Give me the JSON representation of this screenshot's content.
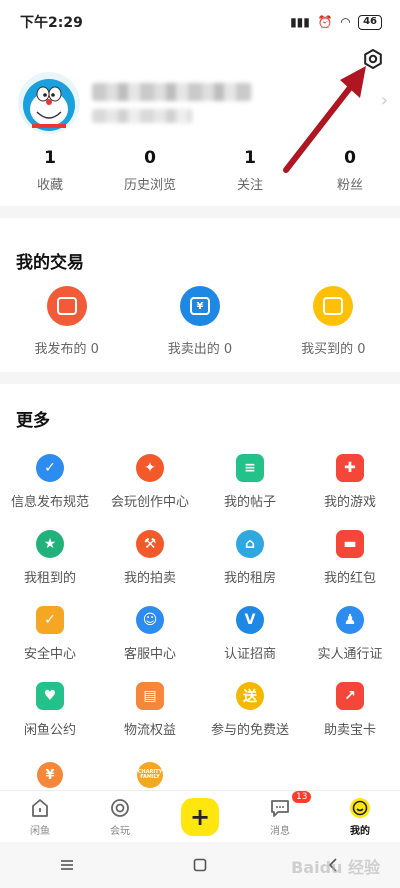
{
  "status_bar": {
    "time": "下午2:29",
    "battery": "46"
  },
  "stats": [
    {
      "value": "1",
      "label": "收藏"
    },
    {
      "value": "0",
      "label": "历史浏览"
    },
    {
      "value": "1",
      "label": "关注"
    },
    {
      "value": "0",
      "label": "粉丝"
    }
  ],
  "trade": {
    "title": "我的交易",
    "items": [
      {
        "label": "我发布的 0",
        "color": "#f25a38",
        "glyph": ""
      },
      {
        "label": "我卖出的 0",
        "color": "#1e88e5",
        "glyph": "¥"
      },
      {
        "label": "我买到的 0",
        "color": "#ffc107",
        "glyph": ""
      }
    ]
  },
  "more": {
    "title": "更多",
    "items": [
      {
        "label": "信息发布规范",
        "color": "#2d8cf0",
        "glyph": "✓"
      },
      {
        "label": "会玩创作中心",
        "color": "#f4592b",
        "glyph": "✦"
      },
      {
        "label": "我的帖子",
        "color": "#22c28a",
        "glyph": "≡"
      },
      {
        "label": "我的游戏",
        "color": "#f4473a",
        "glyph": "✚"
      },
      {
        "label": "我租到的",
        "color": "#20b27a",
        "glyph": "★"
      },
      {
        "label": "我的拍卖",
        "color": "#f4592b",
        "glyph": "⚒"
      },
      {
        "label": "我的租房",
        "color": "#2fa8e0",
        "glyph": "⌂"
      },
      {
        "label": "我的红包",
        "color": "#f4473a",
        "glyph": "▬"
      },
      {
        "label": "安全中心",
        "color": "#f5a623",
        "glyph": "✓"
      },
      {
        "label": "客服中心",
        "color": "#2d8cf0",
        "glyph": "☺"
      },
      {
        "label": "认证招商",
        "color": "#1e88e5",
        "glyph": "V"
      },
      {
        "label": "实人通行证",
        "color": "#2d8cf0",
        "glyph": "♟"
      },
      {
        "label": "闲鱼公约",
        "color": "#22c28a",
        "glyph": "♥"
      },
      {
        "label": "物流权益",
        "color": "#f5873b",
        "glyph": "▤"
      },
      {
        "label": "参与的免费送",
        "color": "#f5b800",
        "glyph": "送"
      },
      {
        "label": "助卖宝卡",
        "color": "#f4473a",
        "glyph": "↗"
      }
    ],
    "extra": [
      {
        "name": "money-bag-icon",
        "color": "#f5873b",
        "glyph": "¥"
      },
      {
        "name": "charity-family-icon",
        "color": "#f5a623",
        "glyph": "CHARITY FAMILY"
      }
    ]
  },
  "tabbar": {
    "tabs": [
      {
        "label": "闲鱼"
      },
      {
        "label": "会玩"
      },
      {
        "label": ""
      },
      {
        "label": "消息",
        "badge": "13"
      },
      {
        "label": "我的"
      }
    ]
  },
  "watermark": "Baidu 经验"
}
